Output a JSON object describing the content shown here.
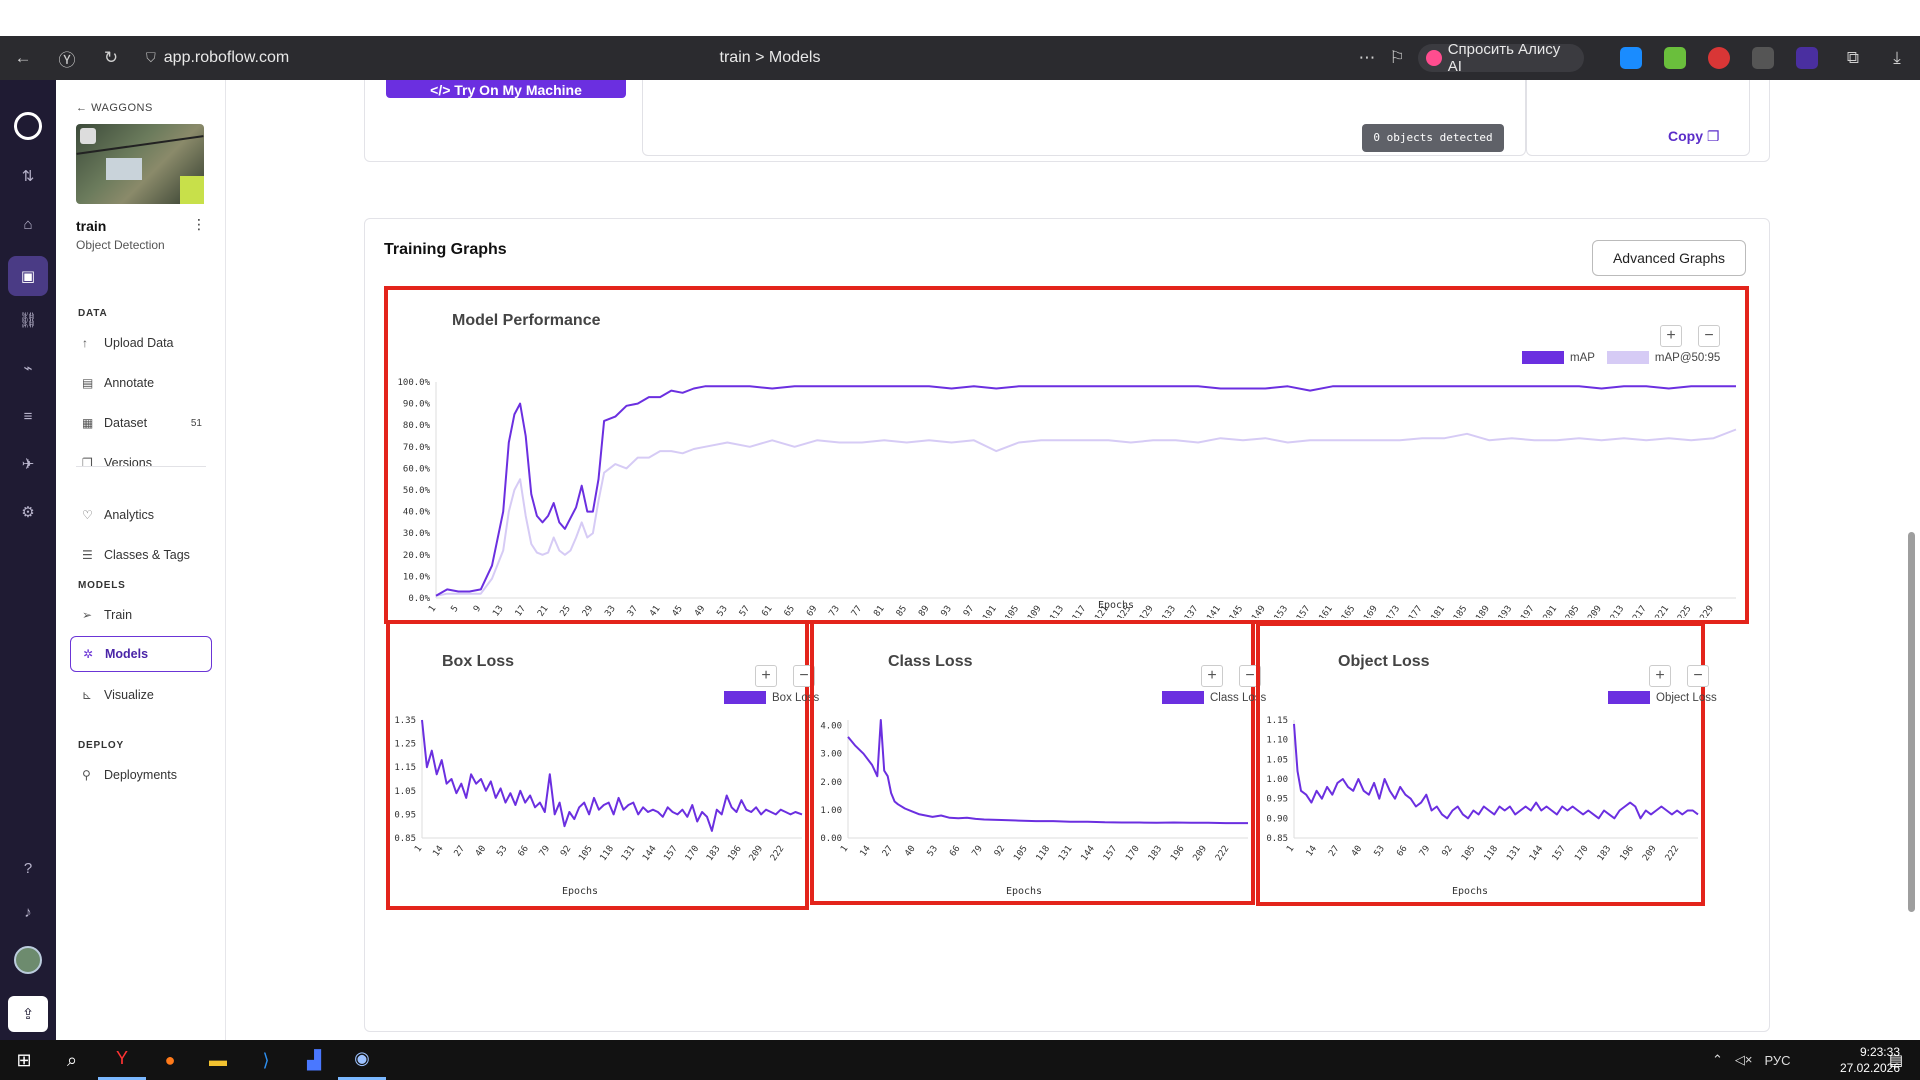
{
  "browser": {
    "url": "app.roboflow.com",
    "tab_title": "train > Models",
    "alice_label": "Спросить Алису AI"
  },
  "sidebar": {
    "back_label": "WAGGONS",
    "project_name": "train",
    "project_type": "Object Detection",
    "sections": {
      "data": "DATA",
      "models": "MODELS",
      "deploy": "DEPLOY"
    },
    "items": [
      {
        "label": "Upload Data",
        "icon": "upload-icon"
      },
      {
        "label": "Annotate",
        "icon": "annotate-icon"
      },
      {
        "label": "Dataset",
        "icon": "dataset-icon",
        "count": "51"
      },
      {
        "label": "Versions",
        "icon": "versions-icon"
      },
      {
        "label": "Analytics",
        "icon": "analytics-icon"
      },
      {
        "label": "Classes & Tags",
        "icon": "list-icon"
      },
      {
        "label": "Train",
        "icon": "train-icon"
      },
      {
        "label": "Models",
        "icon": "models-icon",
        "active": true
      },
      {
        "label": "Visualize",
        "icon": "visualize-icon"
      },
      {
        "label": "Deployments",
        "icon": "rocket-icon"
      }
    ]
  },
  "top_card": {
    "try_button": "</> Try On My Machine",
    "objects_detected": "0 objects detected",
    "copy_label": "Copy"
  },
  "graphs": {
    "title": "Training Graphs",
    "advanced_button": "Advanced Graphs",
    "zoom_in": "+",
    "zoom_out": "−"
  },
  "colors": {
    "accent": "#6b2fe0",
    "accent_light": "#d6cbf5",
    "highlight_border": "#e3241b"
  },
  "chart_data": [
    {
      "type": "line",
      "title": "Model Performance",
      "xlabel": "Epochs",
      "ylabel": "",
      "x_ticks": [
        1,
        5,
        9,
        13,
        17,
        21,
        25,
        29,
        33,
        37,
        41,
        45,
        49,
        53,
        57,
        61,
        65,
        69,
        73,
        77,
        81,
        85,
        89,
        93,
        97,
        101,
        105,
        109,
        113,
        117,
        121,
        125,
        129,
        133,
        137,
        141,
        145,
        149,
        153,
        157,
        161,
        165,
        169,
        173,
        177,
        181,
        185,
        189,
        193,
        197,
        201,
        205,
        209,
        213,
        217,
        221,
        225,
        229
      ],
      "x_range": [
        1,
        233
      ],
      "y_ticks": [
        "100.0%",
        "90.0%",
        "80.0%",
        "70.0%",
        "60.0%",
        "50.0%",
        "40.0%",
        "30.0%",
        "20.0%",
        "10.0%",
        "0.0%"
      ],
      "ylim": [
        0,
        100
      ],
      "series": [
        {
          "name": "mAP",
          "color": "#6b2fe0",
          "x": [
            1,
            3,
            5,
            7,
            9,
            11,
            13,
            14,
            15,
            16,
            17,
            18,
            19,
            20,
            21,
            22,
            23,
            24,
            25,
            26,
            27,
            28,
            29,
            30,
            31,
            33,
            35,
            37,
            39,
            41,
            43,
            45,
            47,
            49,
            53,
            57,
            61,
            65,
            69,
            73,
            77,
            81,
            85,
            89,
            93,
            97,
            101,
            105,
            109,
            113,
            117,
            121,
            125,
            129,
            133,
            137,
            141,
            145,
            149,
            153,
            157,
            161,
            165,
            169,
            173,
            177,
            181,
            185,
            189,
            193,
            197,
            201,
            205,
            209,
            213,
            217,
            221,
            225,
            229,
            233
          ],
          "y": [
            1,
            4,
            3,
            3,
            4,
            15,
            40,
            72,
            85,
            90,
            75,
            48,
            38,
            35,
            38,
            44,
            35,
            32,
            37,
            42,
            52,
            40,
            40,
            55,
            82,
            84,
            89,
            90,
            93,
            93,
            96,
            95,
            97,
            98,
            98,
            98,
            97,
            98,
            98,
            98,
            98,
            98,
            98,
            98,
            97,
            98,
            97,
            98,
            98,
            98,
            98,
            98,
            98,
            98,
            98,
            98,
            97,
            97,
            97,
            98,
            96,
            98,
            98,
            98,
            98,
            98,
            98,
            98,
            98,
            98,
            98,
            98,
            98,
            97,
            98,
            98,
            97,
            98,
            98,
            98
          ]
        },
        {
          "name": "mAP@50:95",
          "color": "#d6cbf5",
          "x": [
            1,
            3,
            5,
            7,
            9,
            11,
            13,
            14,
            15,
            16,
            17,
            18,
            19,
            20,
            21,
            22,
            23,
            24,
            25,
            26,
            27,
            28,
            29,
            30,
            31,
            33,
            35,
            37,
            39,
            41,
            43,
            45,
            47,
            49,
            53,
            57,
            61,
            65,
            69,
            73,
            77,
            81,
            85,
            89,
            93,
            97,
            101,
            105,
            109,
            113,
            117,
            121,
            125,
            129,
            133,
            137,
            141,
            145,
            149,
            153,
            157,
            161,
            165,
            169,
            173,
            177,
            181,
            185,
            189,
            193,
            197,
            201,
            205,
            209,
            213,
            217,
            221,
            225,
            229,
            233
          ],
          "y": [
            1,
            2,
            2,
            2,
            2,
            9,
            22,
            40,
            50,
            55,
            38,
            25,
            21,
            20,
            21,
            28,
            22,
            20,
            22,
            28,
            35,
            28,
            30,
            45,
            58,
            62,
            60,
            65,
            65,
            68,
            68,
            67,
            69,
            70,
            72,
            70,
            73,
            70,
            73,
            72,
            72,
            73,
            72,
            73,
            72,
            73,
            68,
            72,
            73,
            73,
            73,
            73,
            72,
            73,
            73,
            72,
            74,
            73,
            74,
            72,
            73,
            73,
            73,
            73,
            73,
            74,
            74,
            76,
            73,
            74,
            73,
            73,
            74,
            73,
            74,
            73,
            74,
            73,
            74,
            78
          ]
        }
      ],
      "legend": "top-right"
    },
    {
      "type": "line",
      "title": "Box Loss",
      "xlabel": "Epochs",
      "x_ticks": [
        1,
        14,
        27,
        40,
        53,
        66,
        79,
        92,
        105,
        118,
        131,
        144,
        157,
        170,
        183,
        196,
        209,
        222
      ],
      "x_range": [
        1,
        233
      ],
      "y_ticks": [
        "1.35",
        "1.25",
        "1.15",
        "1.05",
        "0.95",
        "0.85"
      ],
      "ylim": [
        0.85,
        1.35
      ],
      "series": [
        {
          "name": "Box Loss",
          "color": "#6b2fe0",
          "x": [
            1,
            4,
            7,
            10,
            13,
            16,
            19,
            22,
            25,
            28,
            31,
            34,
            37,
            40,
            43,
            46,
            49,
            52,
            55,
            58,
            61,
            64,
            67,
            70,
            73,
            76,
            79,
            82,
            85,
            88,
            91,
            94,
            97,
            100,
            103,
            106,
            109,
            112,
            115,
            118,
            121,
            124,
            127,
            130,
            133,
            136,
            139,
            142,
            145,
            148,
            151,
            154,
            157,
            160,
            163,
            166,
            169,
            172,
            175,
            178,
            181,
            184,
            187,
            190,
            193,
            196,
            199,
            202,
            205,
            208,
            211,
            214,
            217,
            220,
            223,
            226,
            229,
            233
          ],
          "y": [
            1.36,
            1.15,
            1.22,
            1.12,
            1.18,
            1.08,
            1.1,
            1.04,
            1.08,
            1.02,
            1.12,
            1.08,
            1.1,
            1.05,
            1.09,
            1.02,
            1.06,
            1.0,
            1.04,
            0.99,
            1.05,
            1.0,
            1.03,
            0.98,
            1.0,
            0.96,
            1.12,
            0.95,
            1.0,
            0.9,
            0.96,
            0.93,
            0.98,
            1.0,
            0.95,
            1.02,
            0.97,
            0.99,
            1.0,
            0.95,
            1.02,
            0.97,
            0.99,
            1.0,
            0.95,
            0.98,
            0.96,
            0.97,
            0.96,
            0.94,
            0.98,
            0.96,
            0.95,
            0.97,
            0.94,
            0.99,
            0.92,
            0.96,
            0.94,
            0.88,
            0.97,
            0.95,
            1.03,
            0.98,
            0.96,
            1.01,
            0.97,
            0.96,
            0.98,
            0.95,
            0.97,
            0.96,
            0.95,
            0.97,
            0.96,
            0.95,
            0.96,
            0.95
          ]
        }
      ],
      "legend": "top-right"
    },
    {
      "type": "line",
      "title": "Class Loss",
      "xlabel": "Epochs",
      "x_ticks": [
        1,
        14,
        27,
        40,
        53,
        66,
        79,
        92,
        105,
        118,
        131,
        144,
        157,
        170,
        183,
        196,
        209,
        222
      ],
      "x_range": [
        1,
        233
      ],
      "y_ticks": [
        "4.00",
        "3.00",
        "2.00",
        "1.00",
        "0.00"
      ],
      "ylim": [
        0,
        4.2
      ],
      "series": [
        {
          "name": "Class Loss",
          "color": "#6b2fe0",
          "x": [
            1,
            5,
            10,
            15,
            18,
            20,
            22,
            24,
            26,
            28,
            30,
            34,
            38,
            42,
            46,
            50,
            55,
            60,
            65,
            70,
            75,
            80,
            90,
            100,
            110,
            120,
            130,
            140,
            150,
            160,
            170,
            180,
            190,
            200,
            210,
            220,
            233
          ],
          "y": [
            3.6,
            3.3,
            3.0,
            2.6,
            2.2,
            4.2,
            2.4,
            2.2,
            1.6,
            1.3,
            1.2,
            1.05,
            0.95,
            0.85,
            0.8,
            0.75,
            0.8,
            0.72,
            0.7,
            0.72,
            0.68,
            0.66,
            0.64,
            0.62,
            0.6,
            0.6,
            0.58,
            0.58,
            0.56,
            0.55,
            0.55,
            0.54,
            0.55,
            0.54,
            0.54,
            0.53,
            0.53
          ]
        }
      ],
      "legend": "top-right"
    },
    {
      "type": "line",
      "title": "Object Loss",
      "xlabel": "Epochs",
      "x_ticks": [
        1,
        14,
        27,
        40,
        53,
        66,
        79,
        92,
        105,
        118,
        131,
        144,
        157,
        170,
        183,
        196,
        209,
        222
      ],
      "x_range": [
        1,
        233
      ],
      "y_ticks": [
        "1.15",
        "1.10",
        "1.05",
        "1.00",
        "0.95",
        "0.90",
        "0.85"
      ],
      "ylim": [
        0.85,
        1.15
      ],
      "series": [
        {
          "name": "Object Loss",
          "color": "#6b2fe0",
          "x": [
            1,
            3,
            5,
            8,
            11,
            14,
            17,
            20,
            23,
            26,
            29,
            32,
            35,
            38,
            41,
            44,
            47,
            50,
            53,
            56,
            59,
            62,
            65,
            68,
            71,
            74,
            77,
            80,
            83,
            86,
            89,
            92,
            95,
            98,
            101,
            104,
            107,
            110,
            113,
            116,
            119,
            122,
            125,
            128,
            131,
            134,
            137,
            140,
            143,
            146,
            149,
            152,
            155,
            158,
            161,
            164,
            167,
            170,
            173,
            176,
            179,
            182,
            185,
            188,
            191,
            194,
            197,
            200,
            203,
            206,
            209,
            212,
            215,
            218,
            221,
            224,
            227,
            230,
            233
          ],
          "y": [
            1.14,
            1.02,
            0.97,
            0.96,
            0.94,
            0.97,
            0.95,
            0.98,
            0.96,
            0.99,
            1.0,
            0.98,
            0.97,
            1.0,
            0.97,
            0.96,
            0.99,
            0.95,
            1.0,
            0.97,
            0.95,
            0.98,
            0.96,
            0.95,
            0.93,
            0.94,
            0.96,
            0.92,
            0.93,
            0.91,
            0.9,
            0.92,
            0.93,
            0.91,
            0.9,
            0.92,
            0.91,
            0.93,
            0.92,
            0.91,
            0.93,
            0.92,
            0.93,
            0.91,
            0.92,
            0.93,
            0.92,
            0.94,
            0.92,
            0.93,
            0.92,
            0.91,
            0.93,
            0.92,
            0.93,
            0.92,
            0.91,
            0.92,
            0.91,
            0.9,
            0.92,
            0.91,
            0.9,
            0.92,
            0.93,
            0.94,
            0.93,
            0.9,
            0.92,
            0.91,
            0.92,
            0.93,
            0.92,
            0.91,
            0.92,
            0.91,
            0.92,
            0.92,
            0.91
          ]
        }
      ],
      "legend": "top-right"
    }
  ],
  "taskbar": {
    "lang": "РУС",
    "time": "9:23:33",
    "date": "27.02.2026"
  }
}
